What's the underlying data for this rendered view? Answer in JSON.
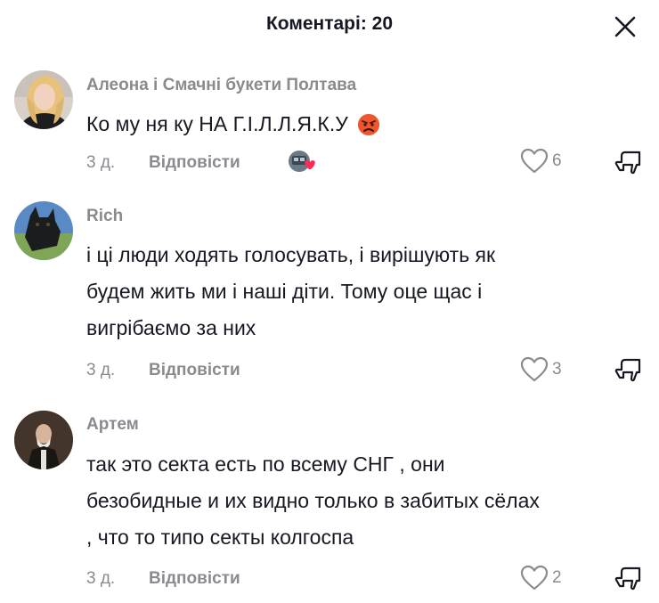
{
  "header": {
    "title": "Коментарі: 20"
  },
  "comments": [
    {
      "username": "Алеона і Смачні букети Полтава",
      "text_lines": [
        "Ко му ня ку НА Г.І.Л.Л.Я.К.У"
      ],
      "time": "3 д.",
      "reply_label": "Відповісти",
      "likes": "6"
    },
    {
      "username": "Rich",
      "text_lines": [
        "і ці люди ходять голосувать, і вирішують як",
        "будем жить ми і наші діти. Тому оце щас і",
        "вигрібаємо за них"
      ],
      "time": "3 д.",
      "reply_label": "Відповісти",
      "likes": "3"
    },
    {
      "username": "Артем",
      "text_lines": [
        "так это секта есть по всему СНГ , они",
        "безобидные и их видно только в забитых сёлах",
        ", что то типо секты колгоспа"
      ],
      "time": "3 д.",
      "reply_label": "Відповісти",
      "likes": "2"
    }
  ],
  "icons": {
    "close": "close-icon",
    "like": "heart-outline-icon",
    "dislike": "thumbs-down-icon",
    "emoji": "angry-face-emoji",
    "creator_liked": "creator-liked-badge"
  },
  "colors": {
    "text_primary": "#161823",
    "text_secondary": "#8a8b91",
    "accent_heart": "#fe2c55",
    "emoji_red": "#e8452c"
  }
}
